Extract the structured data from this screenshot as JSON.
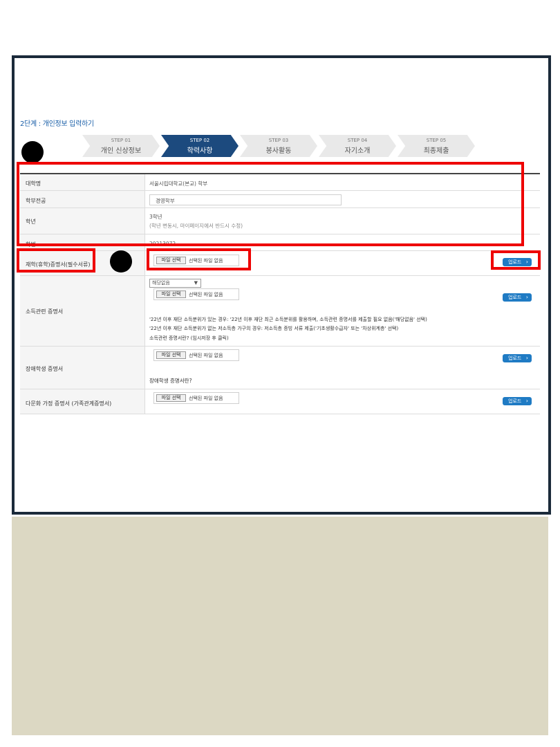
{
  "step_title": "2단계 : 개인정보 입력하기",
  "steps": [
    {
      "label": "STEP 01",
      "name": "개인 신상정보"
    },
    {
      "label": "STEP 02",
      "name": "학력사항"
    },
    {
      "label": "STEP 03",
      "name": "봉사활동"
    },
    {
      "label": "STEP 04",
      "name": "자기소개"
    },
    {
      "label": "STEP 05",
      "name": "최종제출"
    }
  ],
  "active_step": 1,
  "form": {
    "university": {
      "label": "대학명",
      "value": "서울시립대학교(본교) 학부"
    },
    "major": {
      "label": "학부전공",
      "value": "경영학부"
    },
    "grade": {
      "label": "학년",
      "value": "3학년",
      "note": "(학년 변동시, 마이페이지에서 반드시 수정)"
    },
    "student_id": {
      "label": "학번",
      "value": "20213072"
    },
    "enrollment_cert": {
      "label": "재학(휴학)증명서(필수서류)"
    },
    "income_cert": {
      "label": "소득관련 증명서",
      "select_value": "해당없음",
      "note1": "'22년 이후 재단 소득분위가 있는 경우: '22년 이후 재단 최근 소득분위를 활용하며, 소득관련 증명서를 제출할 필요 없음('해당없음' 선택)",
      "note2": "'22년 이후 재단 소득분위가 없는 저소득층 가구의 경우: 저소득층 증빙 서류 제출('기초생활수급자' 또는 '차상위계층' 선택)",
      "note3": "소득관련 증명서란? (임시저장 후 클릭)"
    },
    "disability_cert": {
      "label": "장애학생 증명서",
      "note": "장애학생 증명서란?"
    },
    "multicultural_cert": {
      "label": "다문화 가정 증명서 (가족관계증명서)"
    }
  },
  "file_input": {
    "button": "파일 선택",
    "status": "선택된 파일 없음"
  },
  "upload_button": "업로드",
  "colors": {
    "accent": "#1f7bc4",
    "active_step": "#1c4a7e",
    "highlight": "#ee0000",
    "frame": "#1b2a3a",
    "bottom_panel": "#dcd8c3"
  }
}
